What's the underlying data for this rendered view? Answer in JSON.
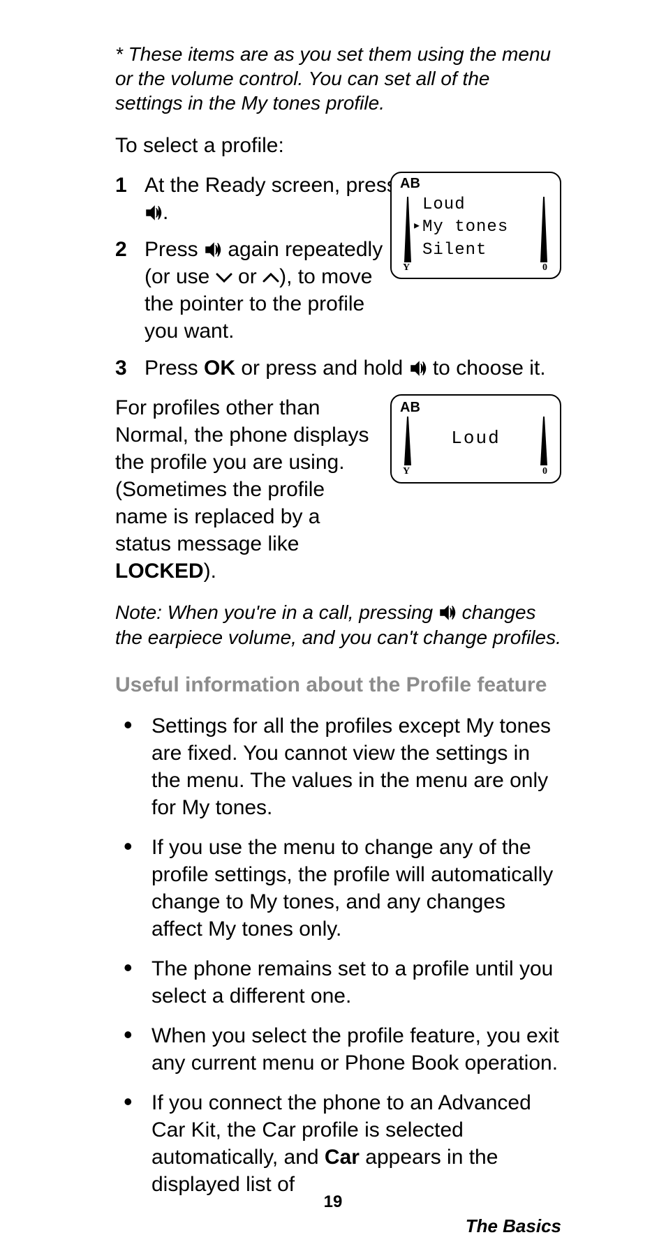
{
  "footnote": "* These items are as you set them using the menu or the volume control. You can set all of the settings in the My tones profile.",
  "intro": "To select a profile:",
  "steps": {
    "s1": {
      "num": "1",
      "pre": "At the Ready screen, press ",
      "post": "."
    },
    "s2": {
      "num": "2",
      "pre": "Press ",
      "mid": " again repeatedly (or use ",
      "or": " or ",
      "post": "), to move the pointer to the profile you want."
    },
    "s3": {
      "num": "3",
      "pre": "Press ",
      "ok": "OK",
      "mid": " or press and hold ",
      "post": " to choose it."
    }
  },
  "screen1": {
    "ab": "AB",
    "item1": "Loud",
    "item2": "My tones",
    "item3": "Silent",
    "yl": "Y",
    "yr": "0"
  },
  "screen2": {
    "ab": "AB",
    "label": "Loud",
    "yl": "Y",
    "yr": "0"
  },
  "para2": {
    "a": "For profiles other than Normal, the phone displays the profile you are using. (Sometimes the profile name is replaced by a status message like ",
    "locked": "LOCKED",
    "b": ")."
  },
  "note": {
    "pre": "Note: When you're in a call, pressing ",
    "post": " changes the earpiece volume, and you can't change profiles."
  },
  "section_head": "Useful information about the Profile feature",
  "bullets": {
    "b1": "Settings for all the profiles except My tones are fixed. You cannot view the settings in the menu. The values in the menu are only for My tones.",
    "b2": "If you use the menu to change any of the profile settings, the profile will automatically change to My tones, and any changes affect My tones only.",
    "b3": "The phone remains set to a profile until you select a different one.",
    "b4": "When you select the profile feature, you exit any current menu or Phone Book operation.",
    "b5_pre": "If you connect the phone to an Advanced Car Kit, the Car profile is selected automatically, and ",
    "b5_car": "Car",
    "b5_post": " appears in the displayed list of"
  },
  "page_num": "19",
  "footer": "The Basics"
}
